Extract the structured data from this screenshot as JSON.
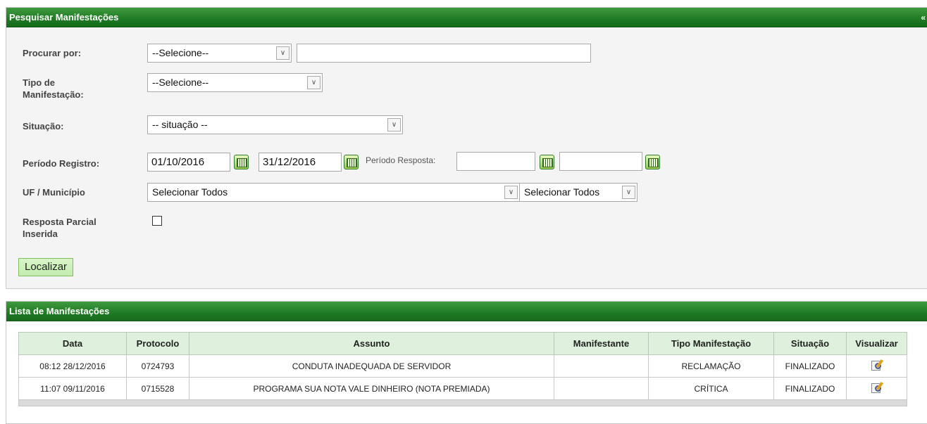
{
  "search_panel": {
    "title": "Pesquisar Manifestações",
    "collapse_glyph": "«",
    "procurar_por": {
      "label": "Procurar por:",
      "select_value": "--Selecione--",
      "text_value": ""
    },
    "tipo": {
      "label_line1": "Tipo de",
      "label_line2": "Manifestação:",
      "select_value": "--Selecione--"
    },
    "situacao": {
      "label": "Situação:",
      "select_value": "-- situação --"
    },
    "periodo_registro": {
      "label": "Período Registro:",
      "start": "01/10/2016",
      "end": "31/12/2016"
    },
    "periodo_resposta": {
      "label": "Período Resposta:",
      "start": "",
      "end": ""
    },
    "uf_municipio": {
      "label": "UF / Município",
      "uf_value": "Selecionar Todos",
      "municipio_value": "Selecionar Todos"
    },
    "resposta_parcial": {
      "label_line1": "Resposta Parcial",
      "label_line2": "Inserida",
      "checked": false
    },
    "localizar_label": "Localizar"
  },
  "list_panel": {
    "title": "Lista de Manifestações",
    "columns": [
      "Data",
      "Protocolo",
      "Assunto",
      "Manifestante",
      "Tipo Manifestação",
      "Situação",
      "Visualizar"
    ],
    "rows": [
      {
        "data": "08:12 28/12/2016",
        "protocolo": "0724793",
        "assunto": "CONDUTA INADEQUADA DE SERVIDOR",
        "manifestante": "",
        "tipo": "RECLAMAÇÃO",
        "situacao": "FINALIZADO",
        "icon": "view-details-icon"
      },
      {
        "data": "11:07 09/11/2016",
        "protocolo": "0715528",
        "assunto": "PROGRAMA SUA NOTA VALE DINHEIRO (NOTA PREMIADA)",
        "manifestante": "",
        "tipo": "CRÍTICA",
        "situacao": "FINALIZADO",
        "icon": "view-details-icon"
      }
    ]
  },
  "colors": {
    "header_green": "#1f7a24",
    "table_header_bg": "#ddf1dc",
    "button_bg": "#c3ecae"
  }
}
